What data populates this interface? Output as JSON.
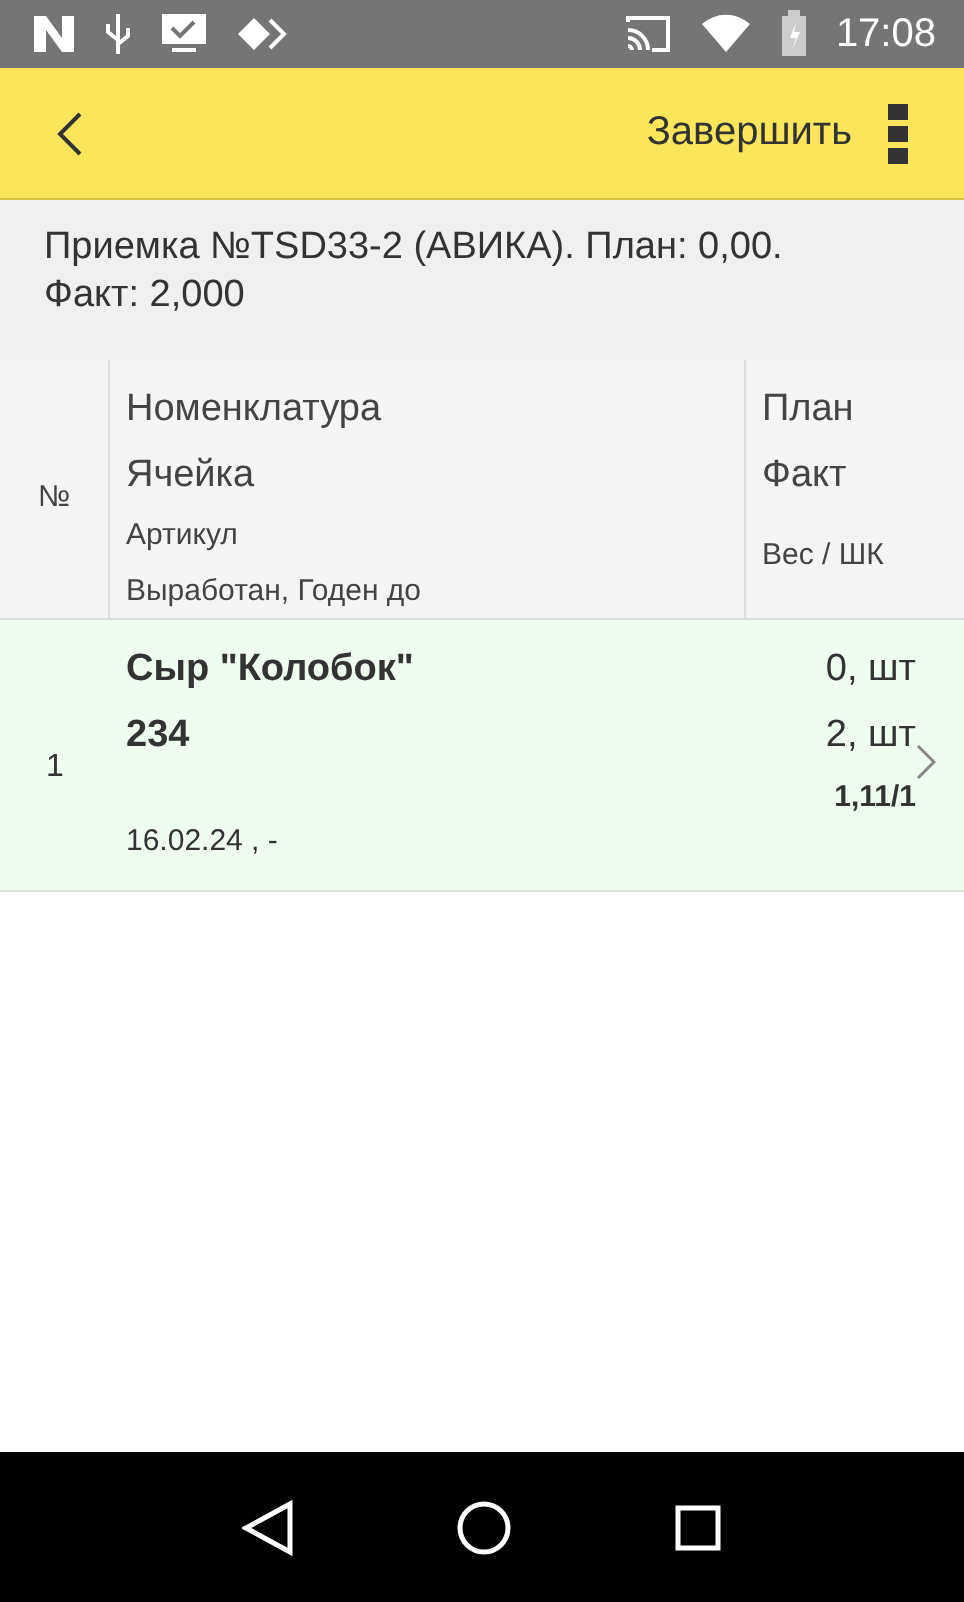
{
  "status_bar": {
    "time": "17:08"
  },
  "toolbar": {
    "action": "Завершить"
  },
  "summary": "Приемка №TSD33-2 (АВИКА). План: 0,00. Факт: 2,000",
  "table": {
    "columns": {
      "number": "№",
      "name": "Номенклатура",
      "cell": "Ячейка",
      "article": "Артикул",
      "dates": "Выработан, Годен до",
      "plan": "План",
      "fact": "Факт",
      "weight": "Вес / ШК"
    },
    "rows": [
      {
        "number": "1",
        "name": "Сыр \"Колобок\"",
        "cell": "234",
        "dates": "16.02.24  , -",
        "plan": "0, шт",
        "fact": "2, шт",
        "weight": "1,11/1",
        "selected": true
      }
    ]
  }
}
